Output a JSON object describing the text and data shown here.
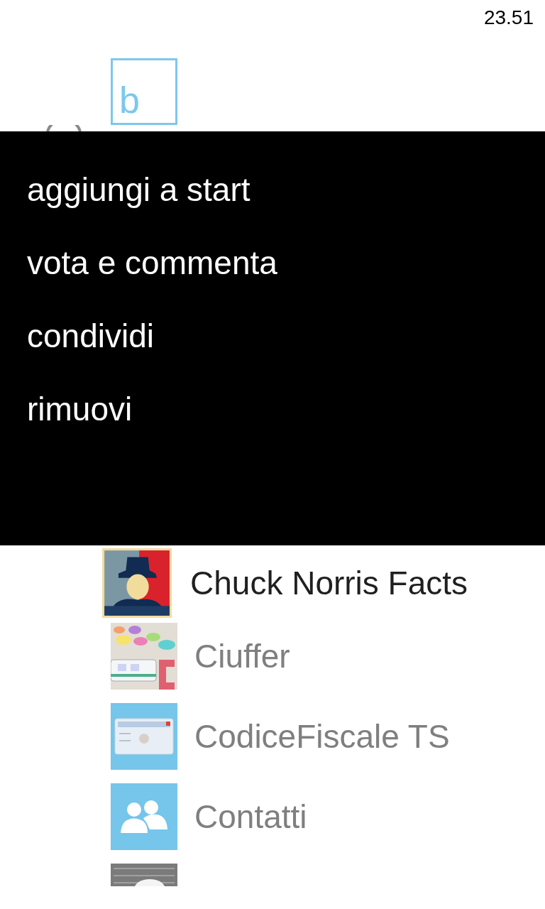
{
  "status_bar": {
    "time": "23.51"
  },
  "letter_tile": {
    "letter": "b"
  },
  "context_menu": {
    "items": [
      "aggiungi a start",
      "vota e commenta",
      "condividi",
      "rimuovi"
    ]
  },
  "apps": [
    {
      "name": "Chuck Norris Facts",
      "selected": true,
      "kind": "picture"
    },
    {
      "name": "Ciuffer",
      "selected": false,
      "kind": "picture"
    },
    {
      "name": "CodiceFiscale TS",
      "selected": false,
      "kind": "picture"
    },
    {
      "name": "Contatti",
      "selected": false,
      "kind": "people"
    },
    {
      "selected": false,
      "kind": "picture"
    }
  ]
}
